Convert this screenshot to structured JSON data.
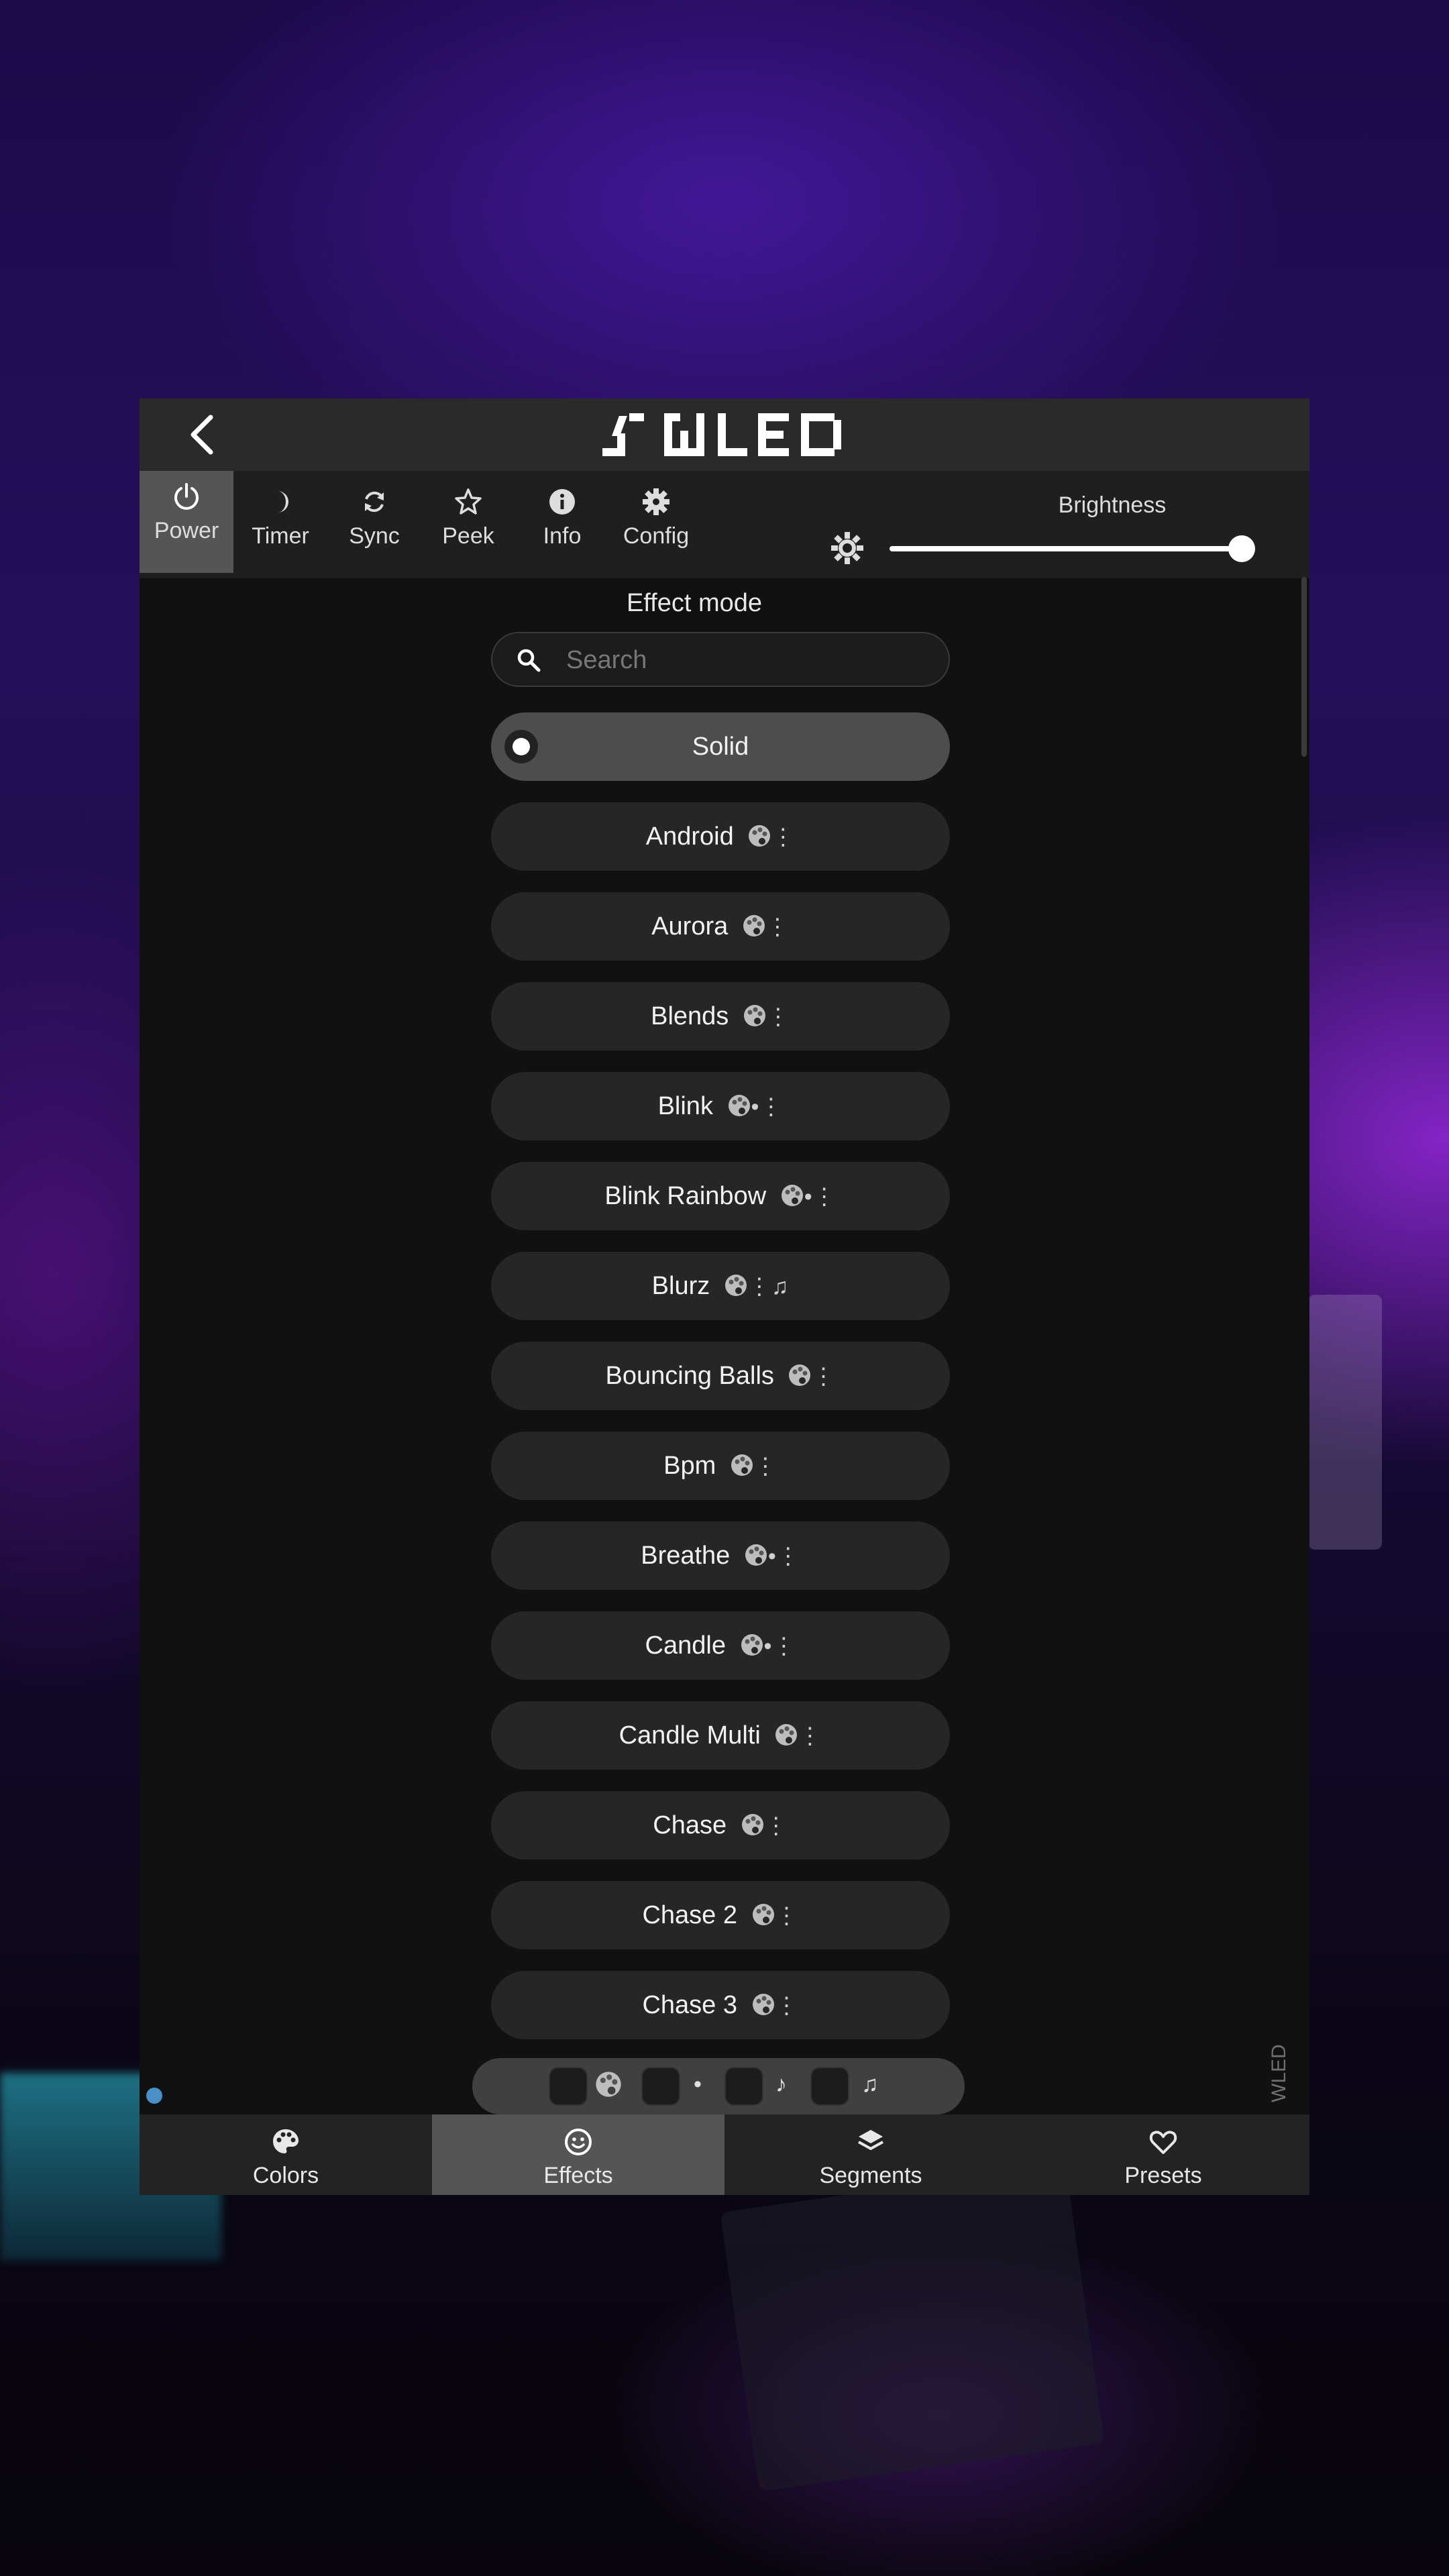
{
  "header": {
    "logo_text": "WLED"
  },
  "toolbar": {
    "buttons": [
      {
        "label": "Power",
        "icon": "power-icon",
        "active": true
      },
      {
        "label": "Timer",
        "icon": "moon-icon",
        "active": false
      },
      {
        "label": "Sync",
        "icon": "sync-icon",
        "active": false
      },
      {
        "label": "Peek",
        "icon": "star-icon",
        "active": false
      },
      {
        "label": "Info",
        "icon": "info-icon",
        "active": false
      },
      {
        "label": "Config",
        "icon": "gear-icon",
        "active": false
      }
    ],
    "brightness_label": "Brightness",
    "brightness_level": 1.0
  },
  "effects": {
    "title": "Effect mode",
    "search_placeholder": "Search",
    "items": [
      {
        "name": "Solid",
        "flags": "",
        "selected": true
      },
      {
        "name": "Android",
        "flags": "⋮"
      },
      {
        "name": "Aurora",
        "flags": "⋮"
      },
      {
        "name": "Blends",
        "flags": "⋮"
      },
      {
        "name": "Blink",
        "flags": "•⋮"
      },
      {
        "name": "Blink Rainbow",
        "flags": "•⋮"
      },
      {
        "name": "Blurz",
        "flags": "⋮♫"
      },
      {
        "name": "Bouncing Balls",
        "flags": "⋮"
      },
      {
        "name": "Bpm",
        "flags": "⋮"
      },
      {
        "name": "Breathe",
        "flags": "•⋮"
      },
      {
        "name": "Candle",
        "flags": "•⋮"
      },
      {
        "name": "Candle Multi",
        "flags": "⋮"
      },
      {
        "name": "Chase",
        "flags": "⋮"
      },
      {
        "name": "Chase 2",
        "flags": "⋮"
      },
      {
        "name": "Chase 3",
        "flags": "⋮"
      }
    ],
    "filters": [
      {
        "symbol": "palette"
      },
      {
        "symbol": "•"
      },
      {
        "symbol": "♪"
      },
      {
        "symbol": "♫"
      }
    ]
  },
  "side_label": "WLED",
  "bottom_nav": [
    {
      "label": "Colors",
      "icon": "palette-icon",
      "active": false
    },
    {
      "label": "Effects",
      "icon": "smiley-icon",
      "active": true
    },
    {
      "label": "Segments",
      "icon": "layers-icon",
      "active": false
    },
    {
      "label": "Presets",
      "icon": "heart-icon",
      "active": false
    }
  ],
  "colors": {
    "panel": "#111111",
    "topbar": "#2a2a2a",
    "active": "#555555",
    "item": "#262626",
    "accent_dot": "#4a90c8"
  }
}
